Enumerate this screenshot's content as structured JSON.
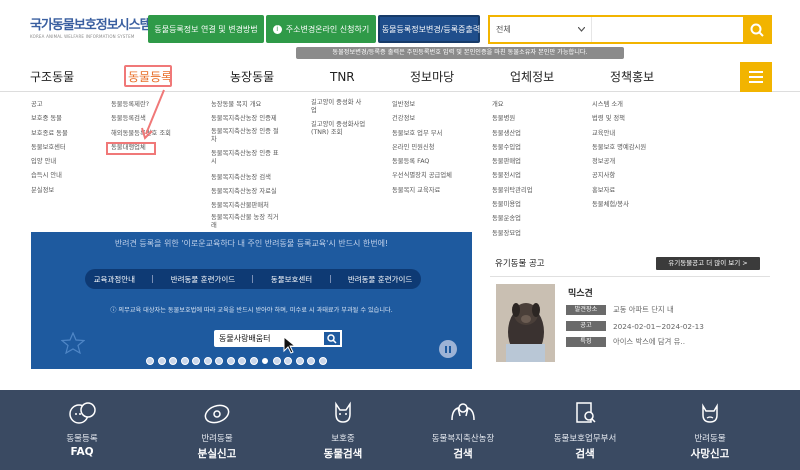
{
  "header": {
    "logo_title": "국가동물보호정보시스템",
    "logo_sub": "KOREA ANIMAL WELFARE INFORMATION SYSTEM",
    "btn_registration_link": "동물등록정보 연결 및 변경방법",
    "btn_address_change": "주소변경온라인 신청하기",
    "btn_info_change": "동물등록정보변경/등록증출력",
    "search_scope": "전체",
    "notice": "동물정보변경/등록증 출력은 주민등록번호 입력 및 본인인증을 마친 동물소유자 본인만 가능합니다."
  },
  "nav": [
    "구조동물",
    "동물등록",
    "농장동물",
    "TNR",
    "정보마당",
    "업체정보",
    "정책홍보"
  ],
  "menu": {
    "col1": [
      "공고",
      "보호중 동물",
      "보호종료 동물",
      "동물보호센터",
      "입양 안내",
      "습득시 안내",
      "분실정보"
    ],
    "col2": [
      "동물등록제란?",
      "동물등록검색",
      "해외동물등록번호 조회",
      "동물대행업체"
    ],
    "col3": [
      "농장동물 복지 개요",
      "동물복지축산농장 인증제",
      "동물복지축산농장 인증 절차",
      "동물복지축산농장 인증 표시",
      "동물복지축산농장 검색",
      "동물복지축산농장 자료실",
      "동물복지축산물판매처",
      "동물복지축산물 농장 직거래"
    ],
    "col4": [
      "길고양이 중성화 사업",
      "길고양이 중성화사업(TNR) 조회"
    ],
    "col5": [
      "일반정보",
      "건강정보",
      "동물보호 업무 부서",
      "온라인 민원신청",
      "동물등록 FAQ",
      "우선식별장치 공급업체",
      "동물복지 교육자료"
    ],
    "col6": [
      "개요",
      "동물병원",
      "동물생산업",
      "동물수입업",
      "동물판매업",
      "동물전시업",
      "동물위탁관리업",
      "동물미용업",
      "동물운송업",
      "동물장묘업"
    ],
    "col7": [
      "시스템 소개",
      "법령 및 정책",
      "교육안내",
      "동물보호 명예감시원",
      "정보공개",
      "공지사항",
      "홍보자료",
      "동물체험/봉사"
    ]
  },
  "banner": {
    "top_text": "반려견 등록을 위한 '이로운교육하다 내 주인 반려동물 등록교육'시 반드시 한번에!",
    "pills": [
      "교육과정안내",
      "반려동물 훈련가이드",
      "동물보호센터",
      "반려동물 훈련가이드"
    ],
    "warning": "ⓘ 의무교육 대상자는 동물보호법에 따라 교육을 반드시 받아야 하며, 미수료 시 과태료가 부과될 수 있습니다.",
    "search_value": "동물사랑배움터"
  },
  "adoption": {
    "title": "유기동물 공고",
    "more": "유기동물공고 더 많이 보기 >",
    "name": "믹스견",
    "rows": [
      {
        "tag": "발견장소",
        "value": "교동 아파트 단지 내"
      },
      {
        "tag": "공고",
        "value": "2024-02-01~2024-02-13"
      },
      {
        "tag": "특징",
        "value": "아이스 박스에 담겨 유.."
      }
    ]
  },
  "bottom": [
    {
      "l1": "동물등록",
      "l2": "FAQ",
      "icon": "chat-bubble-icon"
    },
    {
      "l1": "반려동물",
      "l2": "분실신고",
      "icon": "lost-tag-icon"
    },
    {
      "l1": "보호중",
      "l2": "동물검색",
      "icon": "dog-icon"
    },
    {
      "l1": "동물복지축산농장",
      "l2": "검색",
      "icon": "hands-icon"
    },
    {
      "l1": "동물보호업무부서",
      "l2": "검색",
      "icon": "document-search-icon"
    },
    {
      "l1": "반려동물",
      "l2": "사망신고",
      "icon": "dog-sad-icon"
    }
  ]
}
